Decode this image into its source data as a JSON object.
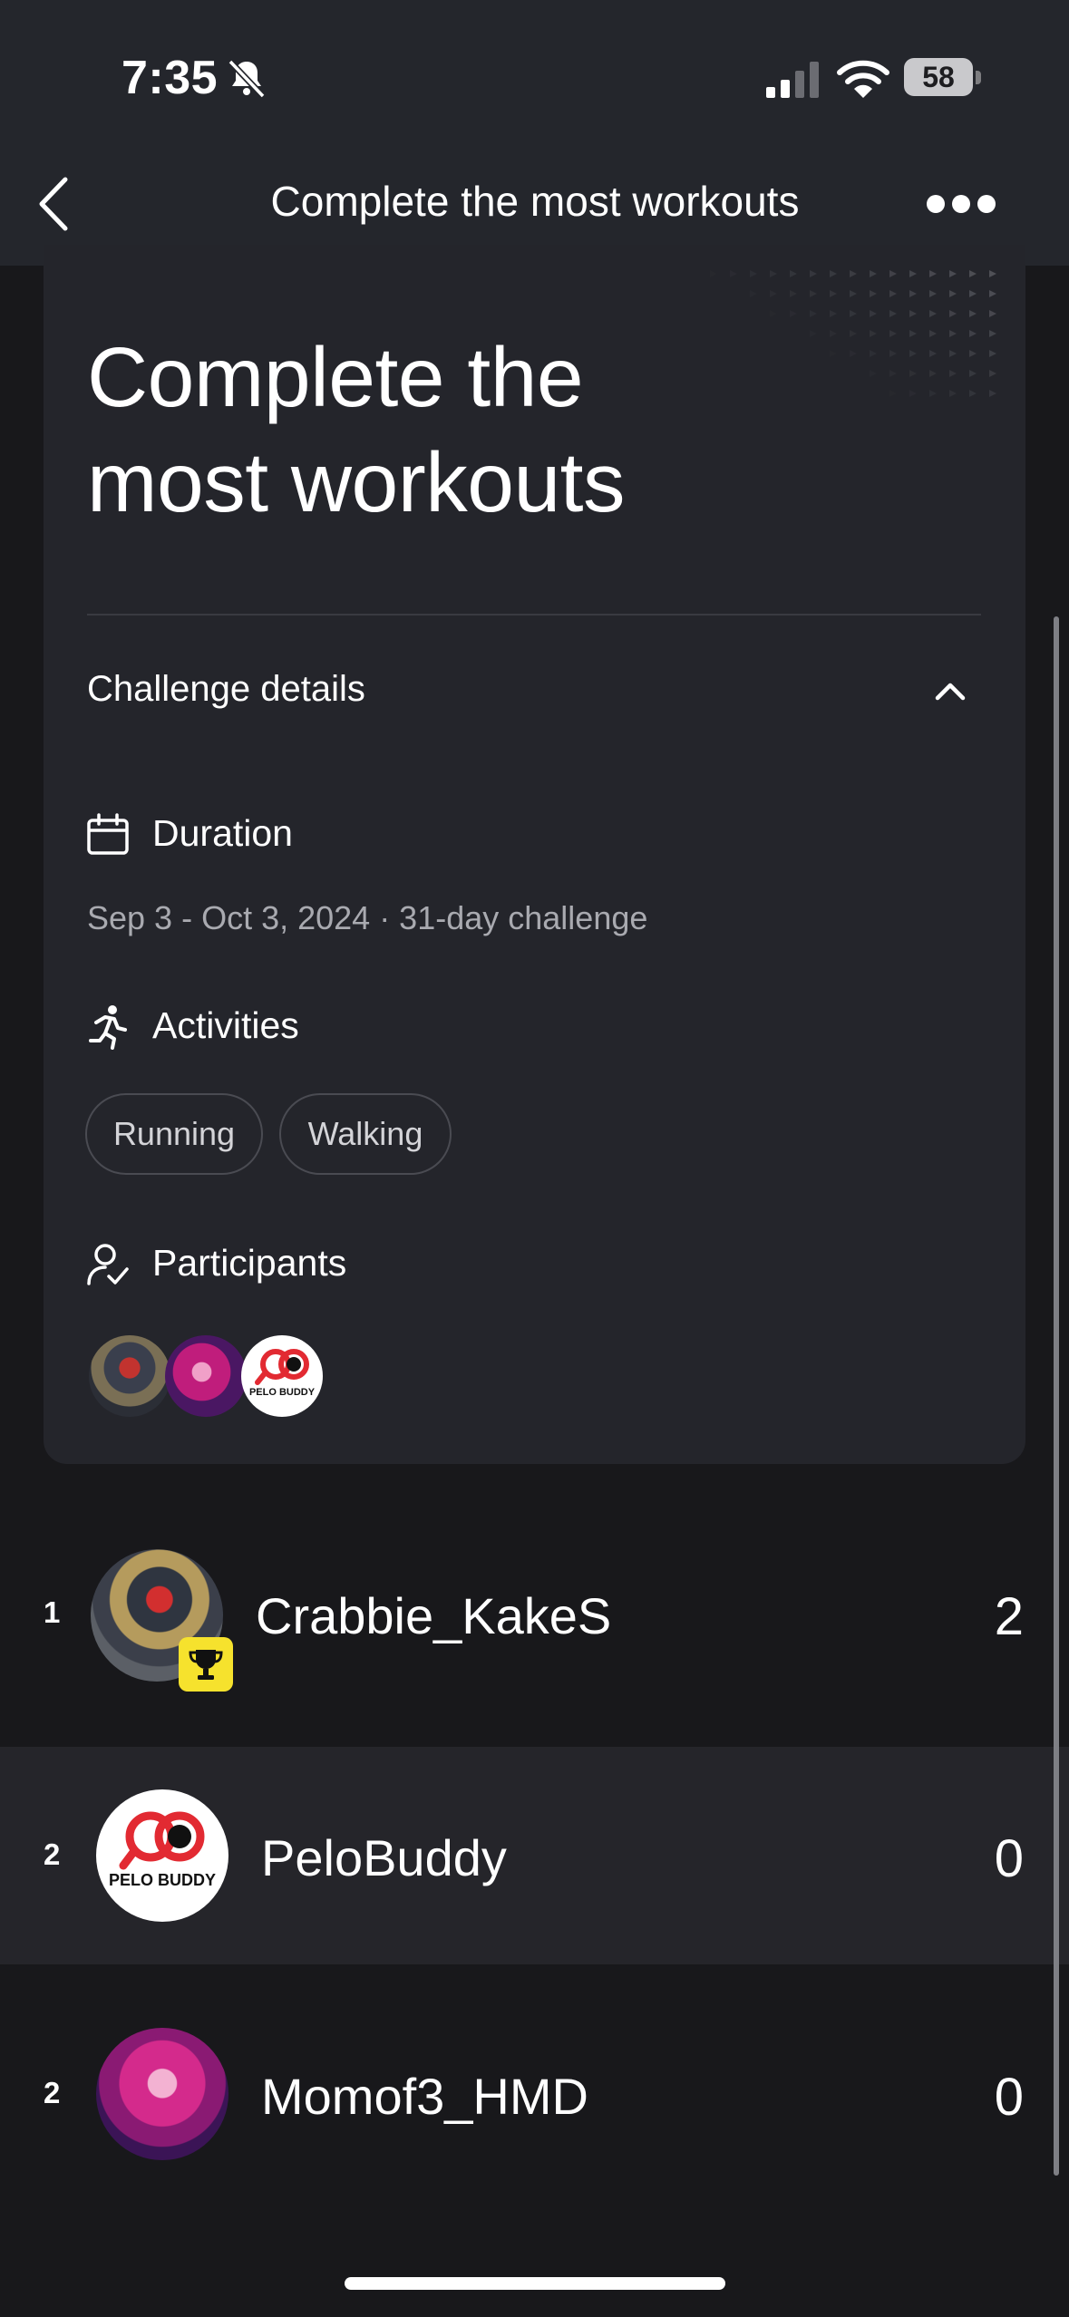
{
  "status_bar": {
    "time": "7:35",
    "battery": "58"
  },
  "nav": {
    "title": "Complete the most workouts"
  },
  "challenge": {
    "title_line1": "Complete the",
    "title_line2": "most workouts",
    "details_label": "Challenge details",
    "duration_label": "Duration",
    "duration_value": "Sep 3 - Oct 3, 2024 · 31-day challenge",
    "activities_label": "Activities",
    "activities": [
      "Running",
      "Walking"
    ],
    "participants_label": "Participants"
  },
  "leaderboard": [
    {
      "rank": "1",
      "name": "Crabbie_KakeS",
      "score": "2"
    },
    {
      "rank": "2",
      "name": "PeloBuddy",
      "score": "0"
    },
    {
      "rank": "2",
      "name": "Momof3_HMD",
      "score": "0"
    }
  ],
  "pelo_logo_text": "PELO BUDDY",
  "colors": {
    "background": "#18181b",
    "card": "#24252b",
    "trophy_badge": "#f6e22d",
    "logo_red": "#e22a32"
  }
}
